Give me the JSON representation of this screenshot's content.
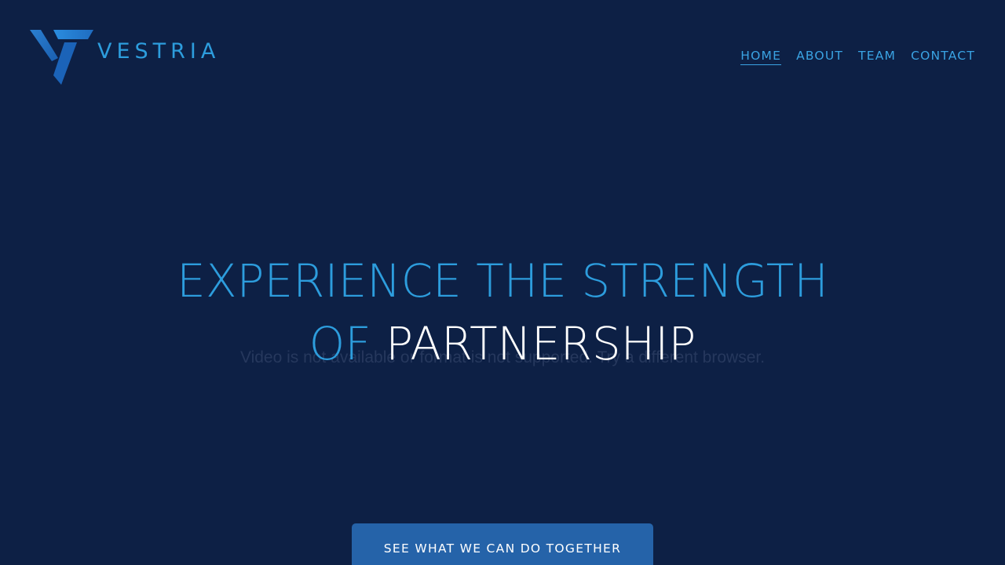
{
  "brand": {
    "name": "VESTRIA",
    "color": "#2d9ddd"
  },
  "nav": {
    "items": [
      {
        "label": "HOME",
        "active": true
      },
      {
        "label": "ABOUT",
        "active": false
      },
      {
        "label": "TEAM",
        "active": false
      },
      {
        "label": "CONTACT",
        "active": false
      }
    ]
  },
  "hero": {
    "line1": "EXPERIENCE THE STRENGTH",
    "line2_accent": "OF",
    "line2_white": "PARTNERSHIP"
  },
  "video": {
    "fallback_text": "Video is not available or format is not supported. Try a different browser."
  },
  "cta": {
    "label": "SEE WHAT WE CAN DO TOGETHER"
  },
  "colors": {
    "background": "#0d2045",
    "accent": "#2d9ddd",
    "cta_background": "#2563a9",
    "white": "#ffffff"
  }
}
